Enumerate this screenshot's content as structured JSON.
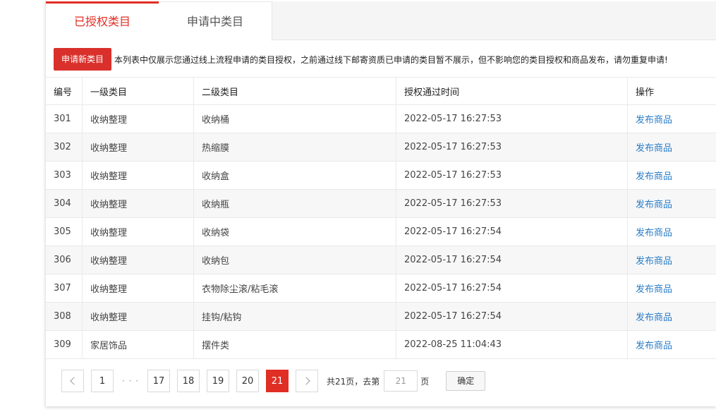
{
  "tabs": [
    {
      "label": "已授权类目",
      "active": true
    },
    {
      "label": "申请中类目",
      "active": false
    }
  ],
  "notice": {
    "button_label": "申请新类目",
    "text": "本列表中仅展示您通过线上流程申请的类目授权，之前通过线下邮寄资质已申请的类目暂不展示，但不影响您的类目授权和商品发布，请勿重复申请!"
  },
  "table": {
    "headers": [
      "编号",
      "一级类目",
      "二级类目",
      "授权通过时间",
      "操作"
    ],
    "rows": [
      {
        "id": "301",
        "cat1": "收纳整理",
        "cat2": "收纳桶",
        "time": "2022-05-17 16:27:53",
        "action": "发布商品"
      },
      {
        "id": "302",
        "cat1": "收纳整理",
        "cat2": "热缩膜",
        "time": "2022-05-17 16:27:53",
        "action": "发布商品"
      },
      {
        "id": "303",
        "cat1": "收纳整理",
        "cat2": "收纳盒",
        "time": "2022-05-17 16:27:53",
        "action": "发布商品"
      },
      {
        "id": "304",
        "cat1": "收纳整理",
        "cat2": "收纳瓶",
        "time": "2022-05-17 16:27:53",
        "action": "发布商品"
      },
      {
        "id": "305",
        "cat1": "收纳整理",
        "cat2": "收纳袋",
        "time": "2022-05-17 16:27:54",
        "action": "发布商品"
      },
      {
        "id": "306",
        "cat1": "收纳整理",
        "cat2": "收纳包",
        "time": "2022-05-17 16:27:54",
        "action": "发布商品"
      },
      {
        "id": "307",
        "cat1": "收纳整理",
        "cat2": "衣物除尘滚/粘毛滚",
        "time": "2022-05-17 16:27:54",
        "action": "发布商品"
      },
      {
        "id": "308",
        "cat1": "收纳整理",
        "cat2": "挂钩/粘钩",
        "time": "2022-05-17 16:27:54",
        "action": "发布商品"
      },
      {
        "id": "309",
        "cat1": "家居饰品",
        "cat2": "摆件类",
        "time": "2022-08-25 11:04:43",
        "action": "发布商品"
      }
    ]
  },
  "pagination": {
    "pages_before": [
      "1"
    ],
    "ellipsis": "· · ·",
    "pages_after": [
      "17",
      "18",
      "19",
      "20"
    ],
    "current": "21",
    "total_text": "共21页，去第",
    "input_value": "21",
    "page_suffix": "页",
    "confirm_label": "确定"
  },
  "colors": {
    "accent": "#e02e24",
    "link": "#2a7cc7"
  }
}
